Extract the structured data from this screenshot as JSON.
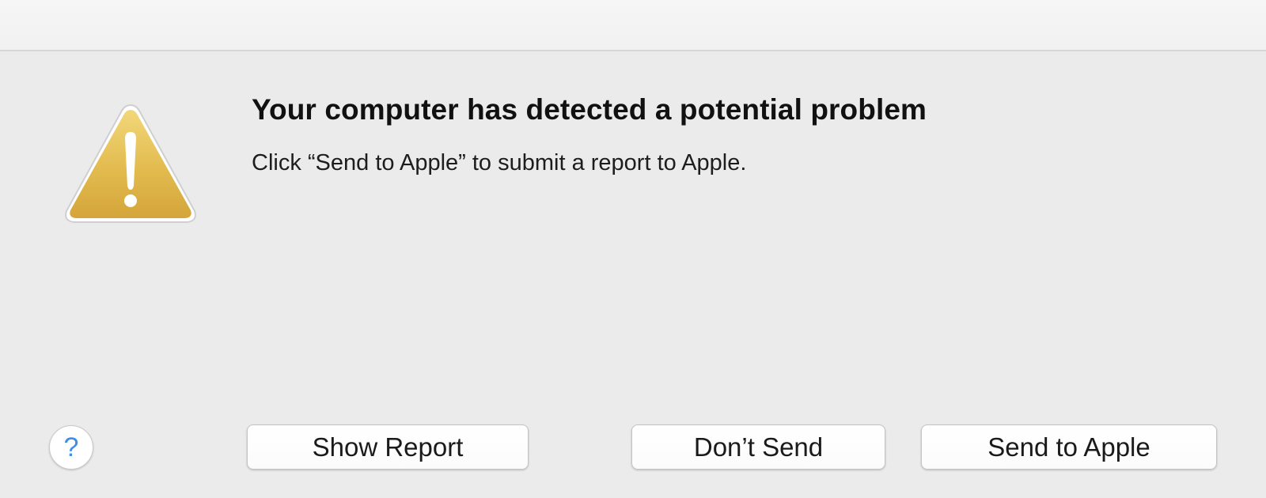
{
  "dialog": {
    "title": "Your computer has detected a potential problem",
    "message": "Click “Send to Apple” to submit a report to Apple.",
    "icon": "warning-icon",
    "help_icon": "question-mark-icon",
    "help_glyph": "?",
    "buttons": {
      "show_report": "Show Report",
      "dont_send": "Don’t Send",
      "send_to_apple": "Send to Apple"
    }
  },
  "colors": {
    "background": "#ebebeb",
    "titlebar": "#f4f4f4",
    "warning_yellow": "#e0b84a",
    "help_blue": "#3d8ee6"
  }
}
